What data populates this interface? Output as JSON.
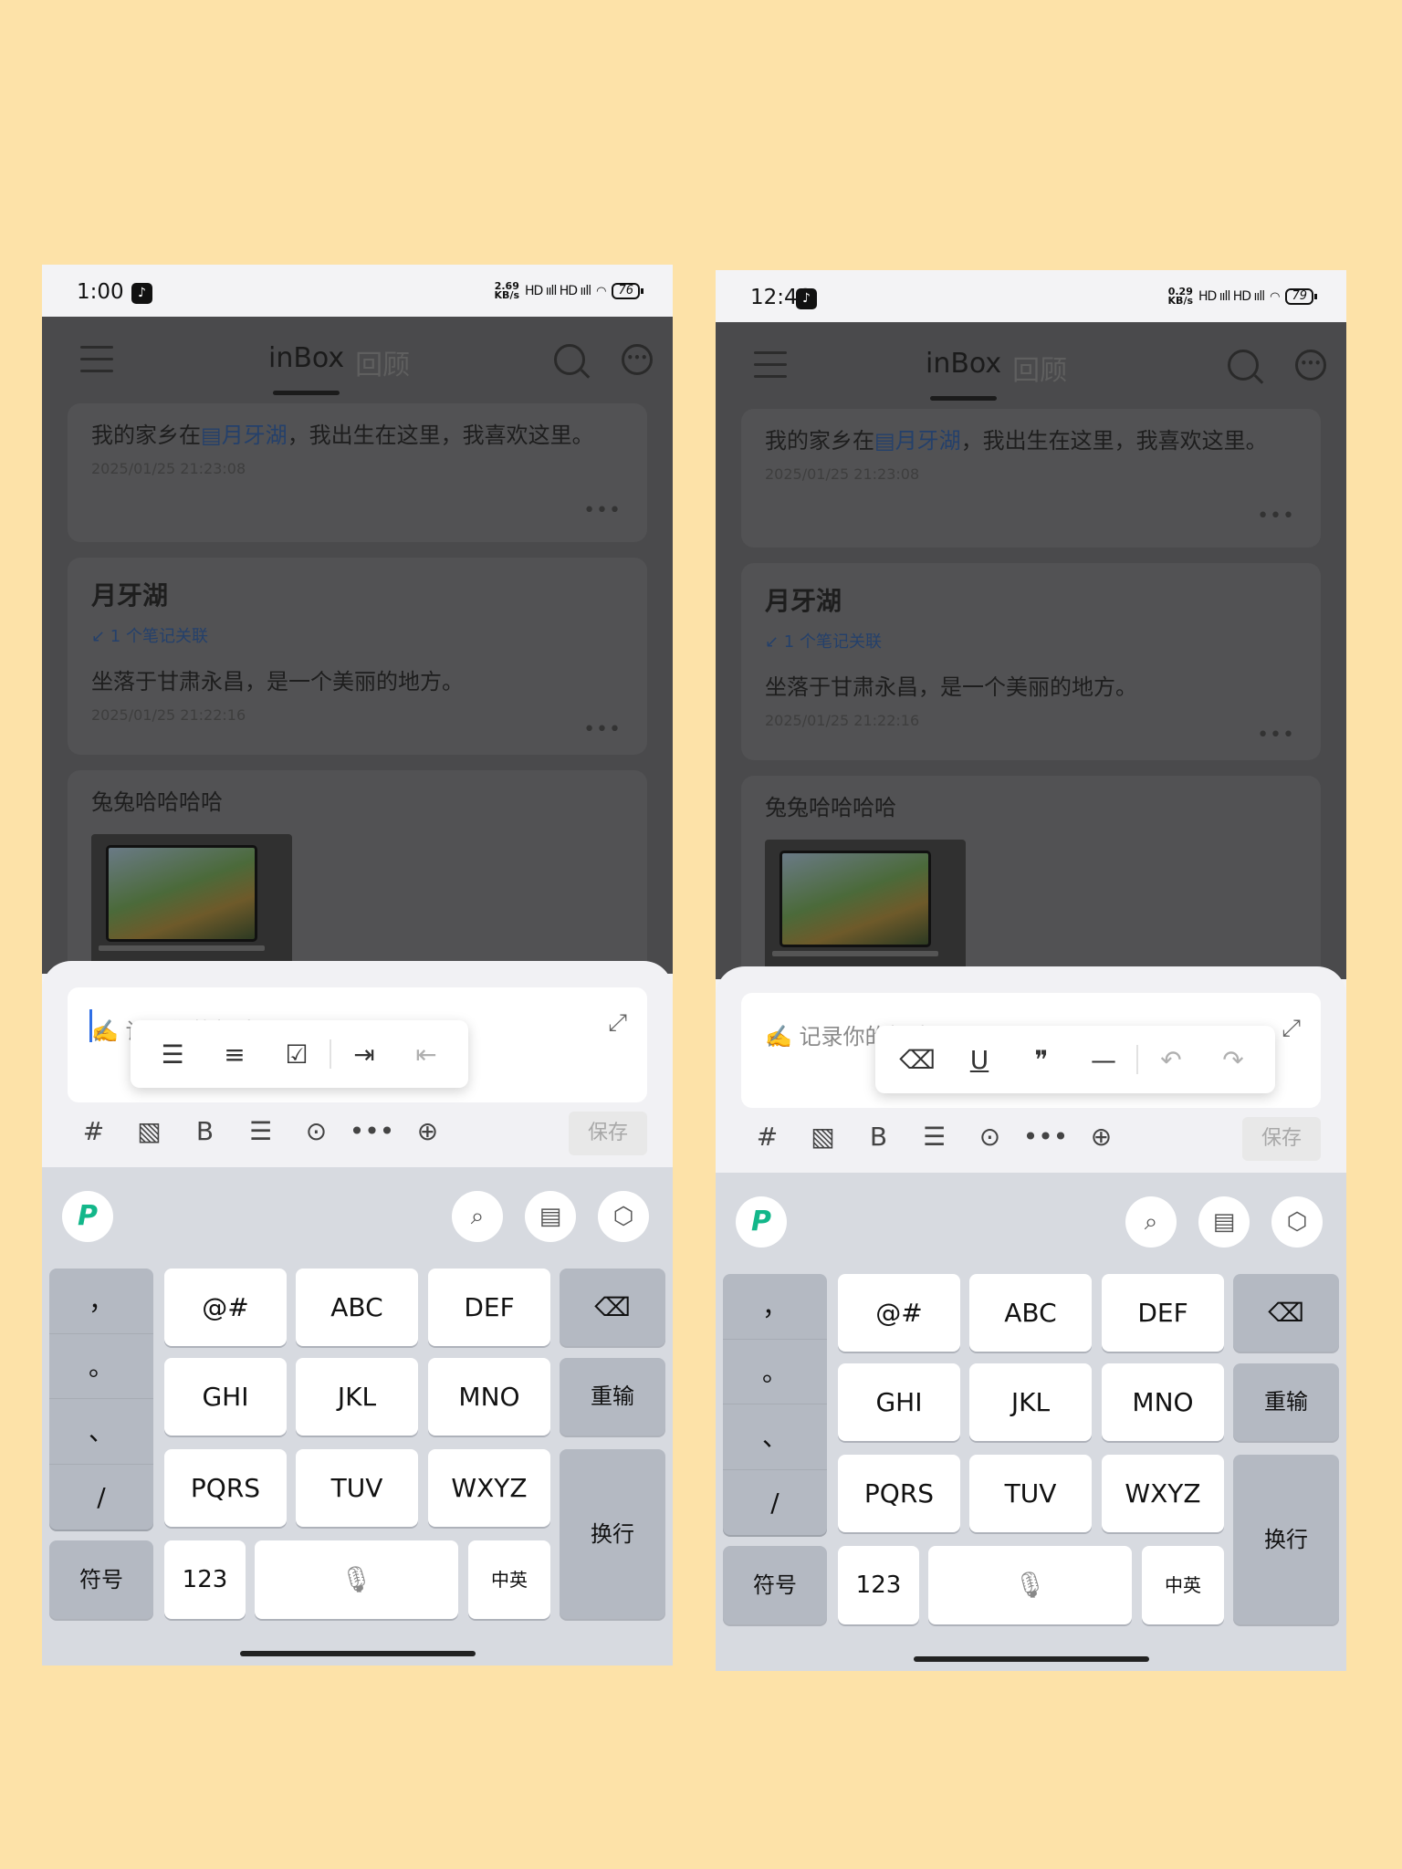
{
  "background_color": "#fde2a8",
  "screens": [
    {
      "status": {
        "time": "1:00",
        "speed_top": "2.69",
        "speed_unit": "KB/s",
        "signal": "HD ııll HD ııll",
        "wifi": "wifi",
        "battery": "76"
      },
      "header": {
        "tab_active": "inBox",
        "tab_inactive": "回顾"
      },
      "cards": {
        "note1": {
          "before": "我的家乡在",
          "link": "月牙湖",
          "after": "，我出生在这里，我喜欢这里。",
          "date": "2025/01/25 21:23:08",
          "more": "•••"
        },
        "note2": {
          "title": "月牙湖",
          "relation": "↙ 1 个笔记关联",
          "body": "坐落于甘肃永昌，是一个美丽的地方。",
          "date": "2025/01/25 21:22:16",
          "more": "•••"
        },
        "note3": {
          "title": "兔兔哈哈哈哈"
        }
      },
      "editor": {
        "placeholder": "✍️ 记录你的想法",
        "expand": "⤢",
        "save": "保存"
      },
      "popup": [
        "☰",
        "≡",
        "☑",
        "⇥",
        "⇤"
      ],
      "toolbar": [
        "#",
        "▧",
        "B",
        "☰",
        "⊙",
        "•••",
        "⊕"
      ],
      "keyboard": {
        "logo": "P",
        "top_icons": [
          "⌕",
          "▤",
          "⬡"
        ],
        "punct": [
          "，",
          "。",
          "、",
          "/"
        ],
        "rows": [
          "@#",
          "ABC",
          "DEF",
          "GHI",
          "JKL",
          "MNO",
          "PQRS",
          "TUV",
          "WXYZ"
        ],
        "backspace": "⌫",
        "retype": "重输",
        "enter": "换行",
        "symbols": "符号",
        "num": "123",
        "mic": "🎙",
        "lang": "中英"
      }
    },
    {
      "status": {
        "time": "12:46",
        "speed_top": "0.29",
        "speed_unit": "KB/s",
        "signal": "HD ııll HD ııll",
        "wifi": "wifi",
        "battery": "79"
      },
      "header": {
        "tab_active": "inBox",
        "tab_inactive": "回顾"
      },
      "cards": {
        "note1": {
          "before": "我的家乡在",
          "link": "月牙湖",
          "after": "，我出生在这里，我喜欢这里。",
          "date": "2025/01/25 21:23:08",
          "more": "•••"
        },
        "note2": {
          "title": "月牙湖",
          "relation": "↙ 1 个笔记关联",
          "body": "坐落于甘肃永昌，是一个美丽的地方。",
          "date": "2025/01/25 21:22:16",
          "more": "•••"
        },
        "note3": {
          "title": "兔兔哈哈哈哈"
        }
      },
      "editor": {
        "placeholder": "✍️ 记录你的想法",
        "expand": "⤢",
        "save": "保存"
      },
      "popup": [
        "⌫",
        "U",
        "❞",
        "—",
        "↶",
        "↷"
      ],
      "toolbar": [
        "#",
        "▧",
        "B",
        "☰",
        "⊙",
        "•••",
        "⊕"
      ],
      "keyboard": {
        "logo": "P",
        "top_icons": [
          "⌕",
          "▤",
          "⬡"
        ],
        "punct": [
          "，",
          "。",
          "、",
          "/"
        ],
        "rows": [
          "@#",
          "ABC",
          "DEF",
          "GHI",
          "JKL",
          "MNO",
          "PQRS",
          "TUV",
          "WXYZ"
        ],
        "backspace": "⌫",
        "retype": "重输",
        "enter": "换行",
        "symbols": "符号",
        "num": "123",
        "mic": "🎙",
        "lang": "中英"
      }
    }
  ]
}
